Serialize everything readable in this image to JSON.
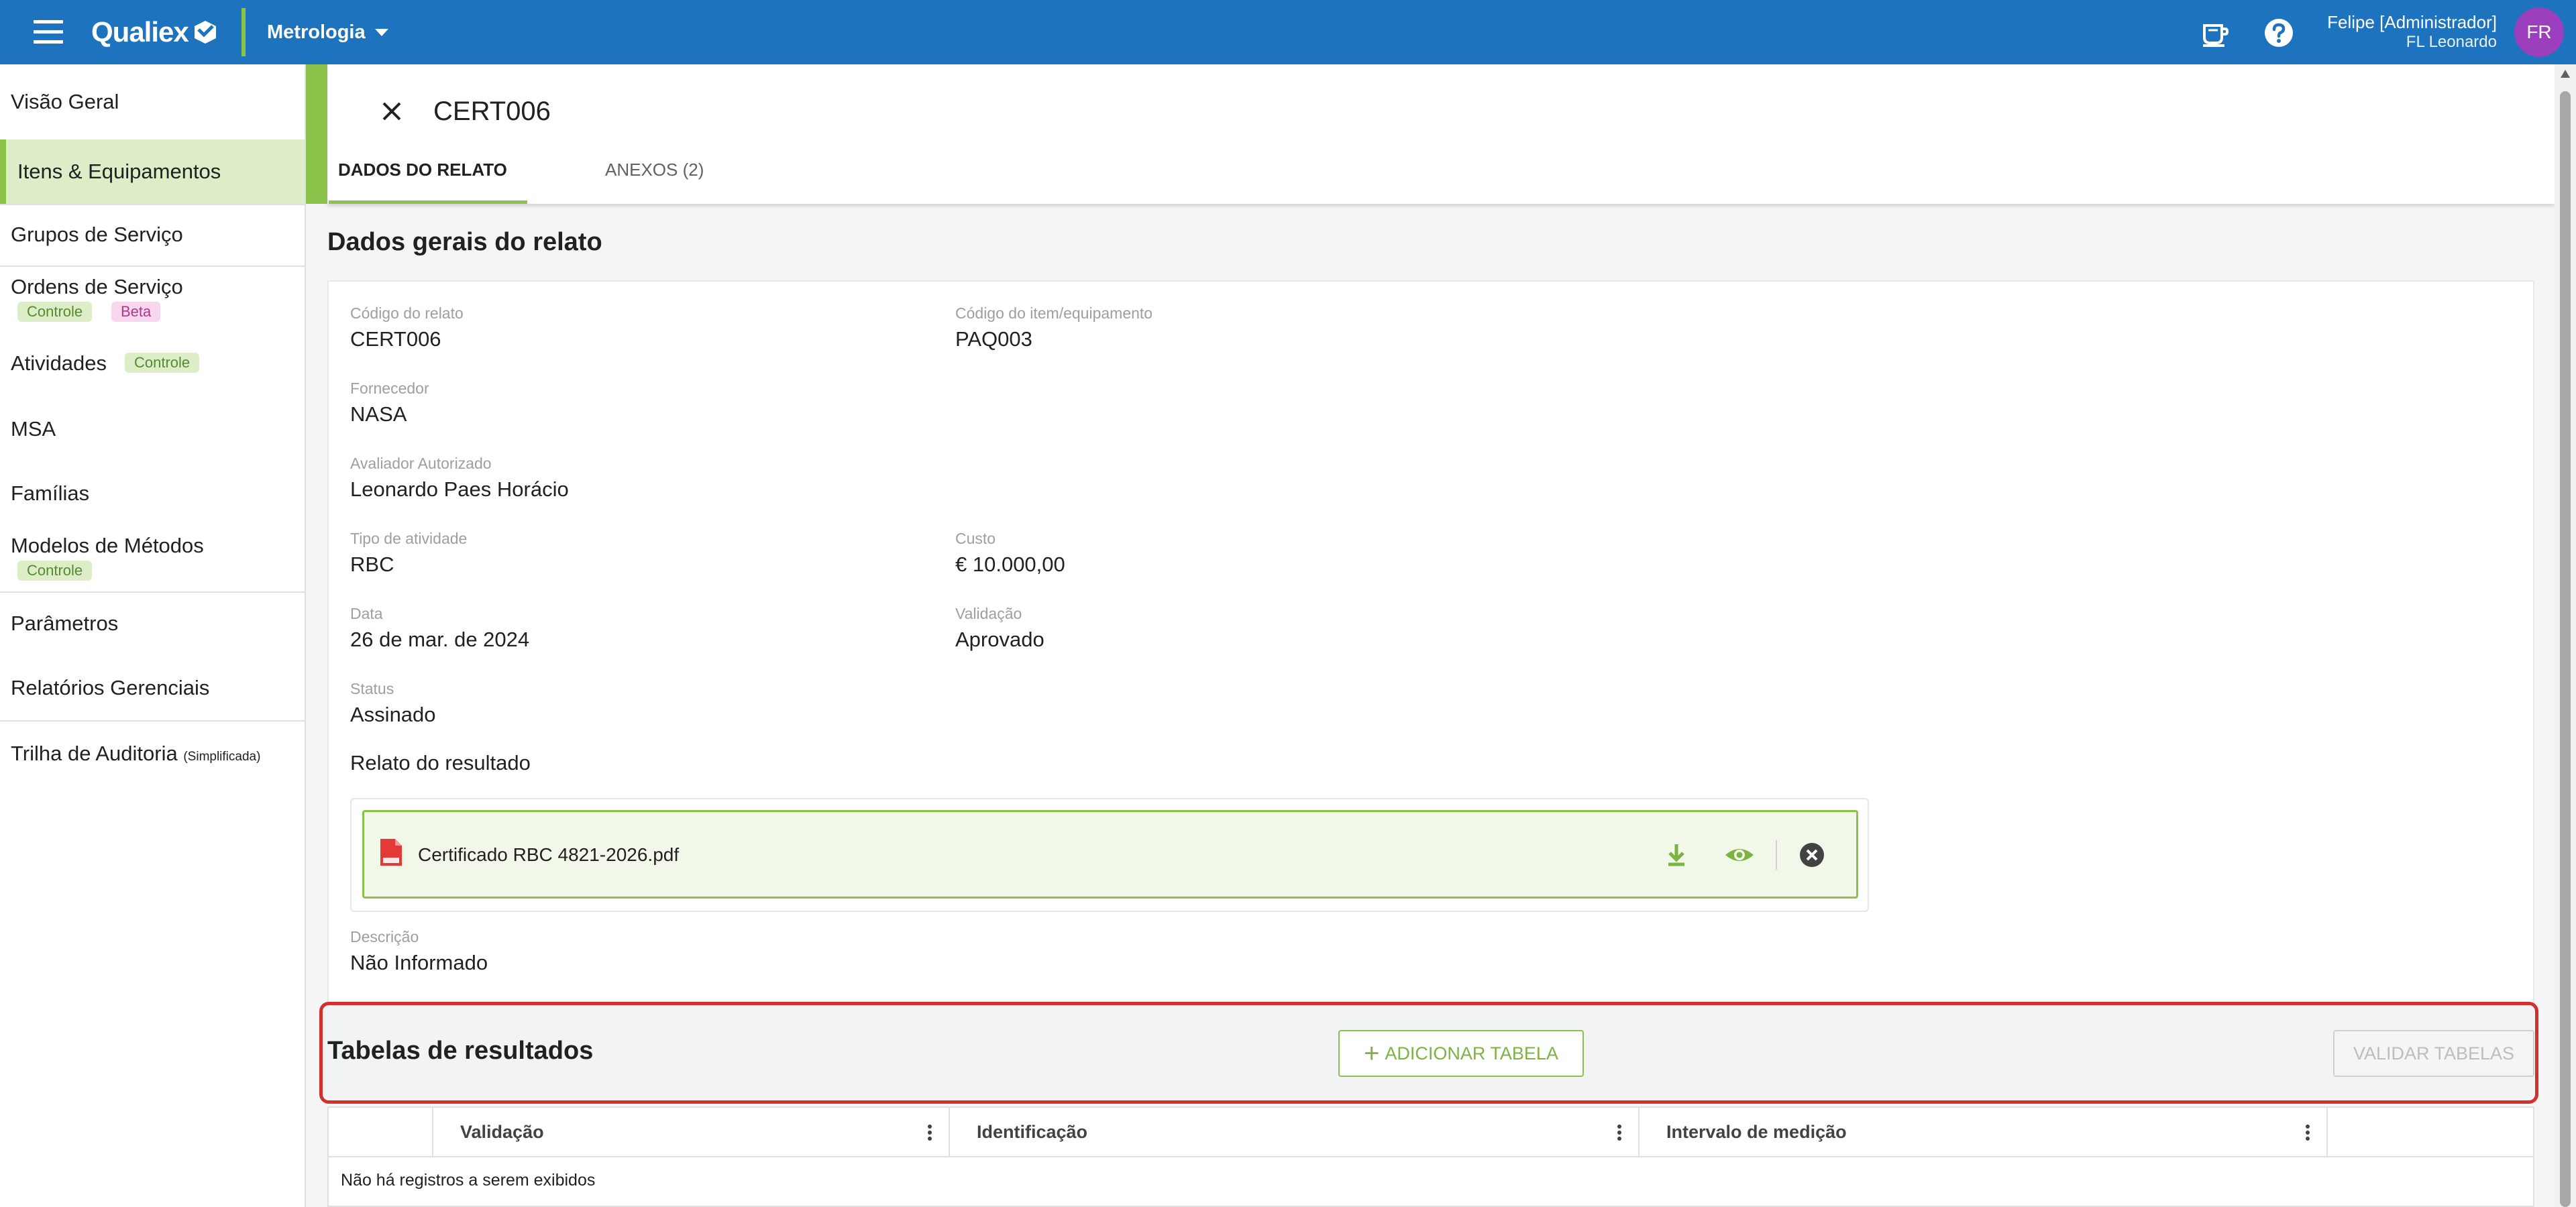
{
  "topbar": {
    "brand": "Qualiex",
    "module": "Metrologia",
    "user_name": "Felipe [Administrador]",
    "user_company": "FL Leonardo",
    "avatar_initials": "FR",
    "brand_color": "#1e73be",
    "accent_color": "#8bc34a"
  },
  "sidebar": {
    "items": [
      {
        "label": "Visão Geral"
      },
      {
        "label": "Itens & Equipamentos",
        "active": true
      },
      {
        "label": "Grupos de Serviço"
      },
      {
        "label": "Ordens de Serviço",
        "badges": [
          "Controle",
          "Beta"
        ]
      },
      {
        "label": "Atividades",
        "badges": [
          "Controle"
        ]
      },
      {
        "label": "MSA"
      },
      {
        "label": "Famílias"
      },
      {
        "label": "Modelos de Métodos",
        "badges": [
          "Controle"
        ]
      },
      {
        "label": "Parâmetros"
      },
      {
        "label": "Relatórios Gerenciais"
      },
      {
        "label": "Trilha de Auditoria",
        "note": "(Simplificada)"
      }
    ]
  },
  "record": {
    "title": "CERT006",
    "tabs": [
      {
        "label": "DADOS DO RELATO",
        "active": true
      },
      {
        "label": "ANEXOS (2)",
        "active": false
      }
    ]
  },
  "details": {
    "section_title": "Dados gerais do relato",
    "fields": {
      "codigo_relato": {
        "label": "Código do relato",
        "value": "CERT006"
      },
      "codigo_item": {
        "label": "Código do item/equipamento",
        "value": "PAQ003"
      },
      "fornecedor": {
        "label": "Fornecedor",
        "value": "NASA"
      },
      "avaliador": {
        "label": "Avaliador Autorizado",
        "value": "Leonardo Paes Horácio"
      },
      "tipo_atividade": {
        "label": "Tipo de atividade",
        "value": "RBC"
      },
      "custo": {
        "label": "Custo",
        "value": "€ 10.000,00"
      },
      "data": {
        "label": "Data",
        "value": "26 de mar. de 2024"
      },
      "validacao": {
        "label": "Validação",
        "value": "Aprovado"
      },
      "status": {
        "label": "Status",
        "value": "Assinado"
      },
      "descricao": {
        "label": "Descrição",
        "value": "Não Informado"
      }
    },
    "relato_label": "Relato do resultado",
    "file": {
      "name": "Certificado RBC 4821-2026.pdf",
      "icon": "pdf-file-icon"
    }
  },
  "tables": {
    "section_title": "Tabelas de resultados",
    "add_button": "ADICIONAR TABELA",
    "validate_button": "VALIDAR TABELAS",
    "columns": [
      "Validação",
      "Identificação",
      "Intervalo de medição"
    ],
    "empty_message": "Não há registros a serem exibidos",
    "highlight_color": "#d32f2f"
  }
}
